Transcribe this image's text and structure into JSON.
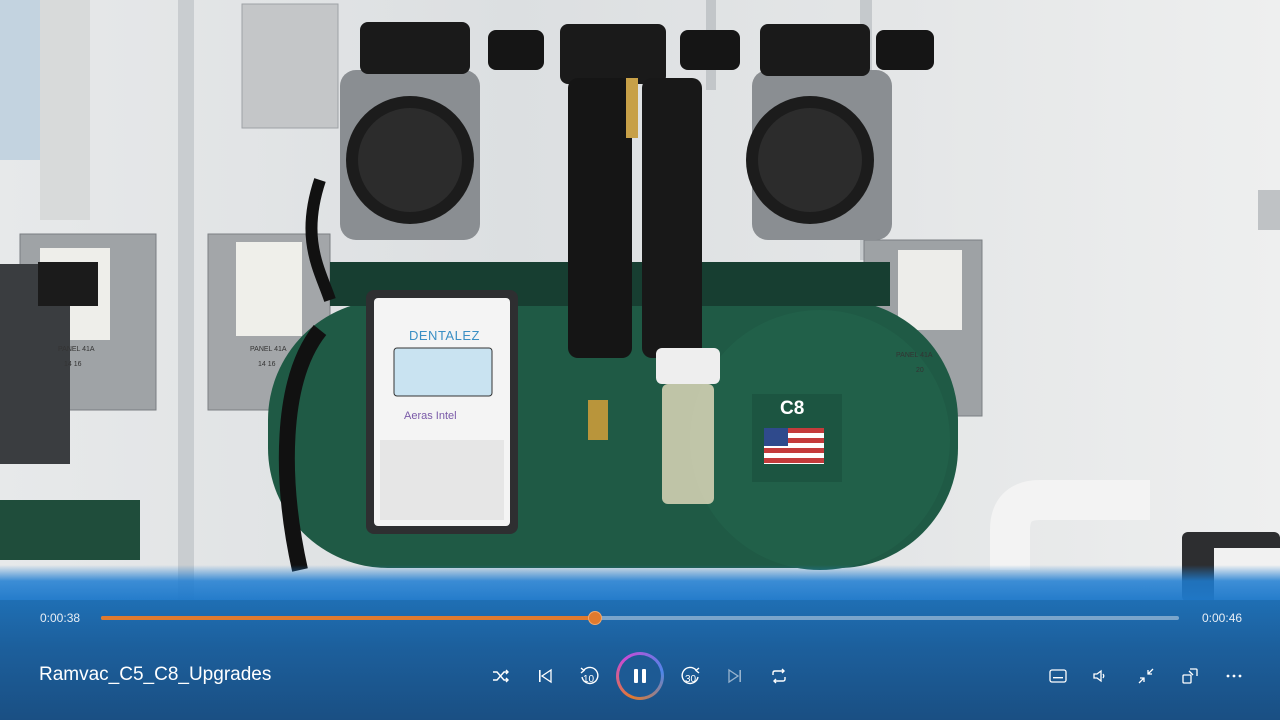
{
  "player": {
    "title": "Ramvac_C5_C8_Upgrades",
    "current_time": "0:00:38",
    "total_time": "0:00:46",
    "progress_fraction": 0.458,
    "accent_color": "#e07a2e",
    "bar_color": "#1f6fb4"
  },
  "video_frame": {
    "unit_label": "C8",
    "brand_label": "DENTALEZ",
    "sub_brand_label": "Aeras Intel",
    "panel_labels": [
      "PANEL 41A",
      "14 16",
      "PANEL 41A",
      "14 16",
      "PANEL 41A",
      "20"
    ]
  },
  "controls": {
    "shuffle_icon": "shuffle-icon",
    "previous_icon": "previous-icon",
    "rewind_label": "10",
    "play_pause_icon": "pause-icon",
    "forward_label": "30",
    "next_icon": "next-icon",
    "repeat_icon": "repeat-icon",
    "captions_icon": "captions-icon",
    "volume_icon": "volume-icon",
    "fullscreen_exit_icon": "exit-fullscreen-icon",
    "mini_player_icon": "mini-player-icon",
    "more_icon": "more-icon"
  }
}
